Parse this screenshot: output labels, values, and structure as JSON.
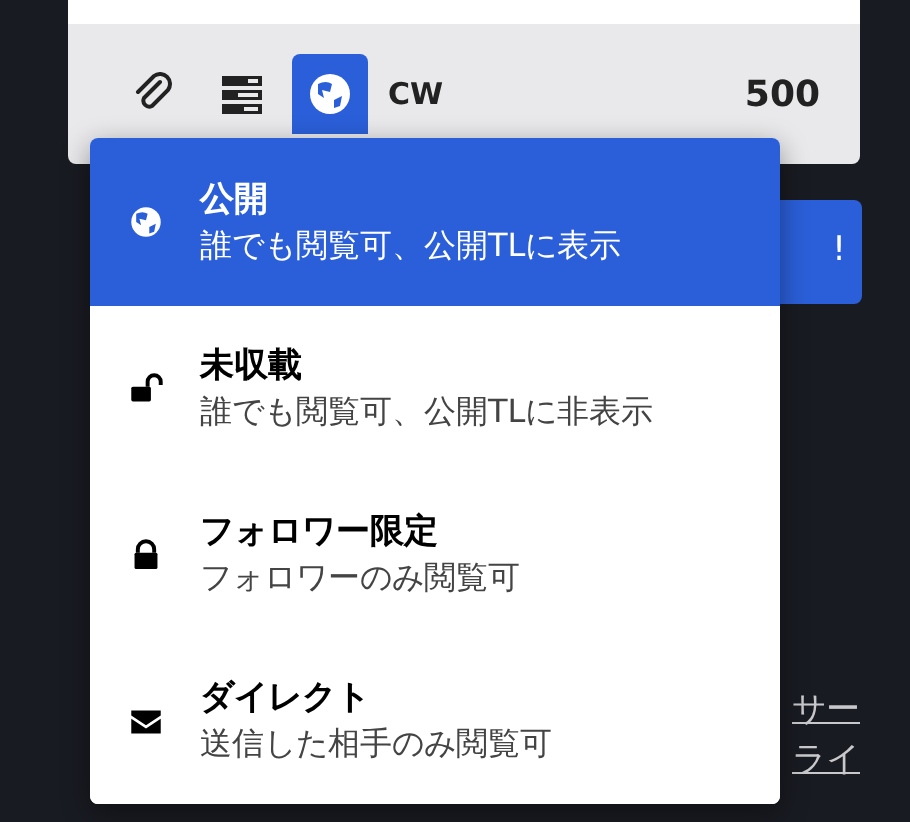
{
  "compose": {
    "tools": [
      {
        "kind": "attach",
        "selected": false
      },
      {
        "kind": "poll",
        "selected": false
      },
      {
        "kind": "visibility",
        "selected": true
      }
    ],
    "cw": "CW",
    "counter": "500"
  },
  "submit_button": {
    "label": "!"
  },
  "visibility_menu": {
    "items": [
      {
        "kind": "public",
        "title": "公開",
        "description": "誰でも閲覧可、公開TLに表示",
        "selected": true
      },
      {
        "kind": "unlisted",
        "title": "未収載",
        "description": "誰でも閲覧可、公開TLに非表示",
        "selected": false
      },
      {
        "kind": "private",
        "title": "フォロワー限定",
        "description": "フォロワーのみ閲覧可",
        "selected": false
      },
      {
        "kind": "direct",
        "title": "ダイレクト",
        "description": "送信した相手のみ閲覧可",
        "selected": false
      }
    ]
  },
  "footer_lines": [
    {
      "end": "サー"
    },
    {
      "end": "ライ"
    }
  ]
}
